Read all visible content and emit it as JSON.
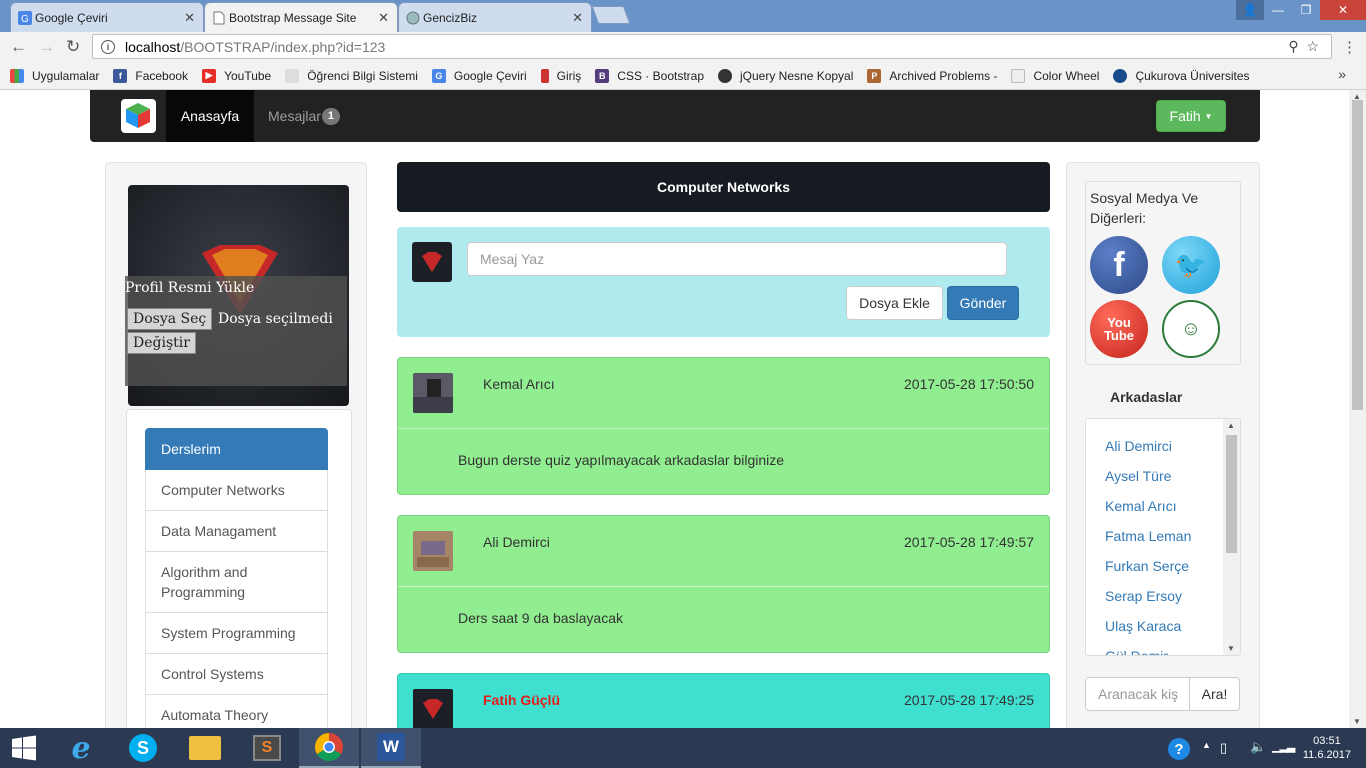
{
  "browser": {
    "tabs": [
      {
        "label": "Google Çeviri",
        "active": false
      },
      {
        "label": "Bootstrap Message Site",
        "active": true
      },
      {
        "label": "GencizBiz",
        "active": false
      }
    ],
    "url_host": "localhost",
    "url_path": "/BOOTSTRAP/index.php?id=123",
    "bookmarks": [
      "Uygulamalar",
      "Facebook",
      "YouTube",
      "Öğrenci Bilgi Sistemi",
      "Google Çeviri",
      "Giriş",
      "CSS · Bootstrap",
      "jQuery Nesne Kopyal",
      "Archived Problems -",
      "Color Wheel",
      "Çukurova Üniversites"
    ]
  },
  "navbar": {
    "home": "Anasayfa",
    "messages": "Mesajlar",
    "messages_count": "1",
    "user": "Fatih"
  },
  "profile": {
    "upload_title": "Profil Resmi Yükle",
    "choose_file": "Dosya Seç",
    "no_file": "Dosya seçilmedi",
    "change": "Değiştir"
  },
  "courses": {
    "header": "Derslerim",
    "items": [
      "Computer Networks",
      "Data Managament",
      "Algorithm and Programming",
      "System Programming",
      "Control Systems",
      "Automata Theory"
    ]
  },
  "channel": {
    "title": "Computer Networks"
  },
  "compose": {
    "placeholder": "Mesaj Yaz",
    "attach": "Dosya Ekle",
    "send": "Gönder"
  },
  "posts": [
    {
      "author": "Kemal Arıcı",
      "time": "2017-05-28 17:50:50",
      "text": "Bugun derste quiz yapılmayacak arkadaslar bilginize"
    },
    {
      "author": "Ali Demirci",
      "time": "2017-05-28 17:49:57",
      "text": "Ders saat 9 da baslayacak"
    },
    {
      "author": "Fatih Güçlü",
      "time": "2017-05-28 17:49:25",
      "text": ""
    }
  ],
  "social": {
    "title": "Sosyal Medya Ve Diğerleri:"
  },
  "friends": {
    "header": "Arkadaslar",
    "items": [
      "Ali Demirci",
      "Aysel Türe",
      "Kemal Arıcı",
      "Fatma Leman",
      "Furkan Serçe",
      "Serap Ersoy",
      "Ulaş Karaca",
      "Gül Demir"
    ],
    "search_placeholder": "Aranacak kiş",
    "search_button": "Ara!"
  },
  "taskbar": {
    "time": "03:51",
    "date": "11.6.2017"
  },
  "colors": {
    "accent_blue": "#337ab7",
    "post_green": "#90ee90",
    "own_post": "#40e0d0",
    "compose_bg": "#aeeaee",
    "success": "#5cb85c"
  }
}
